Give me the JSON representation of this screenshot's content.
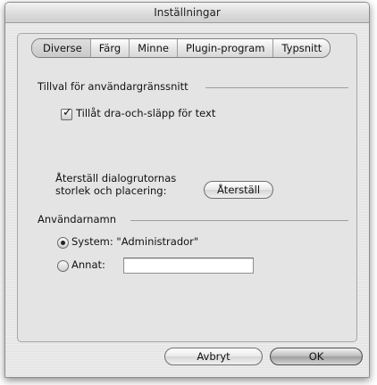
{
  "window": {
    "title": "Inställningar"
  },
  "tabs": [
    {
      "label": "Diverse",
      "selected": true
    },
    {
      "label": "Färg",
      "selected": false
    },
    {
      "label": "Minne",
      "selected": false
    },
    {
      "label": "Plugin-program",
      "selected": false
    },
    {
      "label": "Typsnitt",
      "selected": false
    }
  ],
  "ui_options": {
    "group_label": "Tillval för användargränssnitt",
    "drag_drop_label": "Tillåt dra-och-släpp för text",
    "drag_drop_checked": true
  },
  "reset": {
    "label_line1": "Återställ dialogrutornas",
    "label_line2": "storlek och placering:",
    "button_label": "Återställ"
  },
  "username": {
    "group_label": "Användarnamn",
    "system_label": "System: \"Administrador\"",
    "system_selected": true,
    "other_label": "Annat:",
    "other_value": ""
  },
  "footer": {
    "cancel_label": "Avbryt",
    "ok_label": "OK"
  }
}
